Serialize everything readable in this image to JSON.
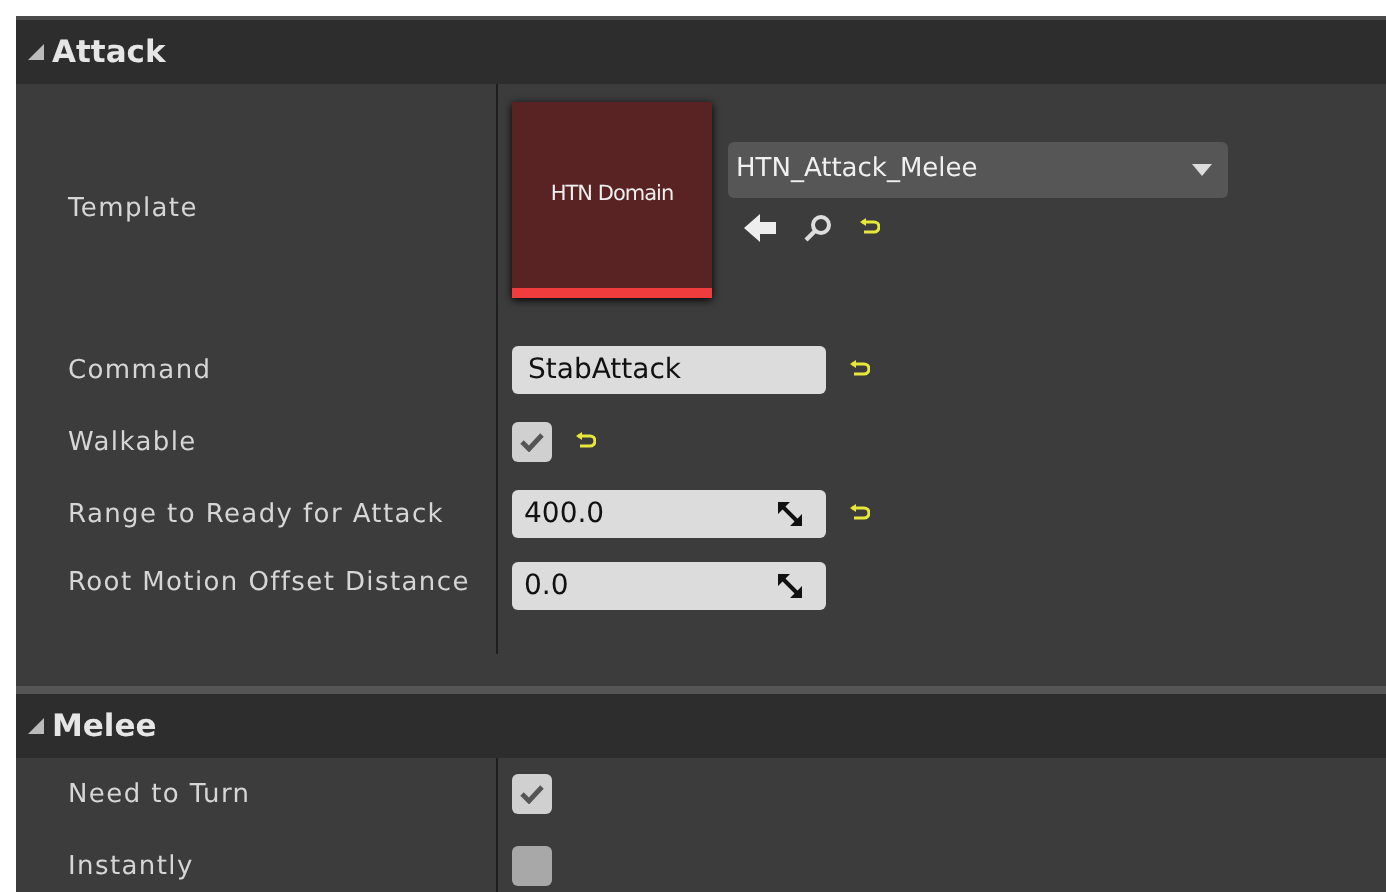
{
  "sections": [
    {
      "title": "Attack",
      "expanded": true,
      "rows": [
        {
          "kind": "asset",
          "label": "Template",
          "thumbnail": "HTN Domain",
          "value": "HTN_Attack_Melee",
          "resettable": true
        },
        {
          "kind": "text",
          "label": "Command",
          "value": "StabAttack",
          "resettable": true
        },
        {
          "kind": "checkbox",
          "label": "Walkable",
          "checked": true,
          "resettable": true
        },
        {
          "kind": "number",
          "label": "Range to Ready for Attack",
          "value": "400.0",
          "resettable": true
        },
        {
          "kind": "number",
          "label": "Root Motion Offset Distance",
          "value": "0.0",
          "resettable": false
        }
      ]
    },
    {
      "title": "Melee",
      "expanded": true,
      "rows": [
        {
          "kind": "checkbox",
          "label": "Need to Turn",
          "checked": true,
          "resettable": false
        },
        {
          "kind": "checkbox",
          "label": "Instantly",
          "checked": false,
          "resettable": false
        }
      ]
    }
  ]
}
